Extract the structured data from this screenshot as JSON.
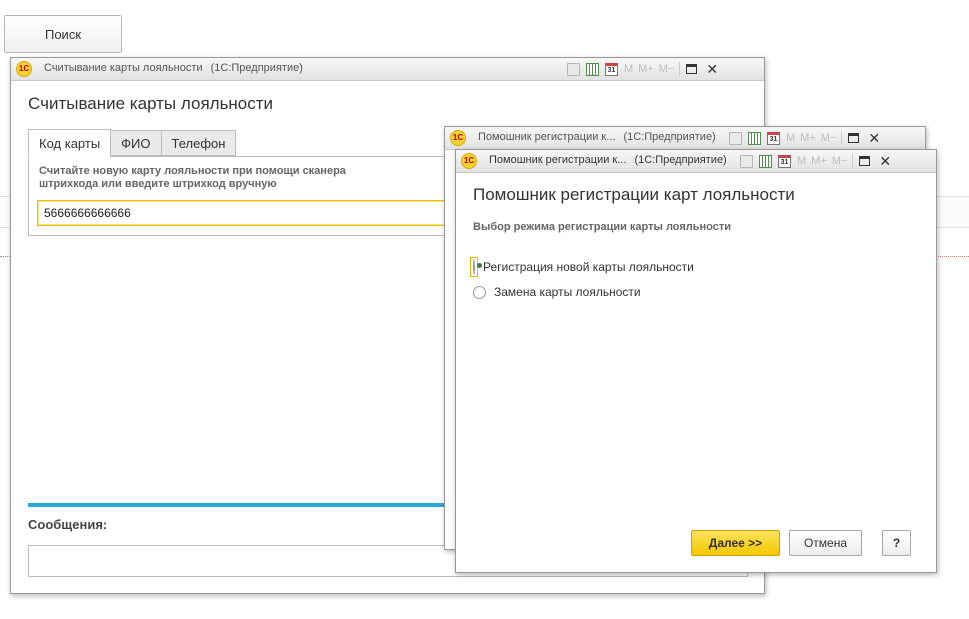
{
  "search_button": {
    "label": "Поиск"
  },
  "loyalty_window": {
    "title": "Считывание карты лояльности",
    "app_suffix": "(1С:Предприятие)",
    "heading": "Считывание карты лояльности",
    "tabs": [
      {
        "label": "Код карты",
        "active": true
      },
      {
        "label": "ФИО",
        "active": false
      },
      {
        "label": "Телефон",
        "active": false
      }
    ],
    "hint_line1": "Считайте новую карту лояльности при помощи сканера",
    "hint_line2": "штрихкода или введите штрихкод вручную",
    "barcode_value": "5666666666666",
    "messages_label": "Сообщения:"
  },
  "back_wizard_window": {
    "title": "Помошник регистрации к...",
    "app_suffix": "(1С:Предприятие)"
  },
  "wizard_window": {
    "title": "Помошник регистрации к...",
    "app_suffix": "(1С:Предприятие)",
    "heading": "Помошник регистрации карт лояльности",
    "subheading": "Выбор режима регистрации карты лояльности",
    "options": [
      {
        "label": "Регистрация новой карты лояльности",
        "selected": true
      },
      {
        "label": "Замена карты лояльности",
        "selected": false
      }
    ],
    "next_label": "Далее >>",
    "cancel_label": "Отмена",
    "help_label": "?"
  },
  "toolbar": {
    "logo_text": "1С",
    "calendar_day": "31",
    "m": "M",
    "m_plus": "M+",
    "m_minus": "M−",
    "close": "✕"
  },
  "colors": {
    "accent_blue": "#2aa6d8",
    "primary_yellow": "#f5c800",
    "focus_border": "#f0c000"
  }
}
